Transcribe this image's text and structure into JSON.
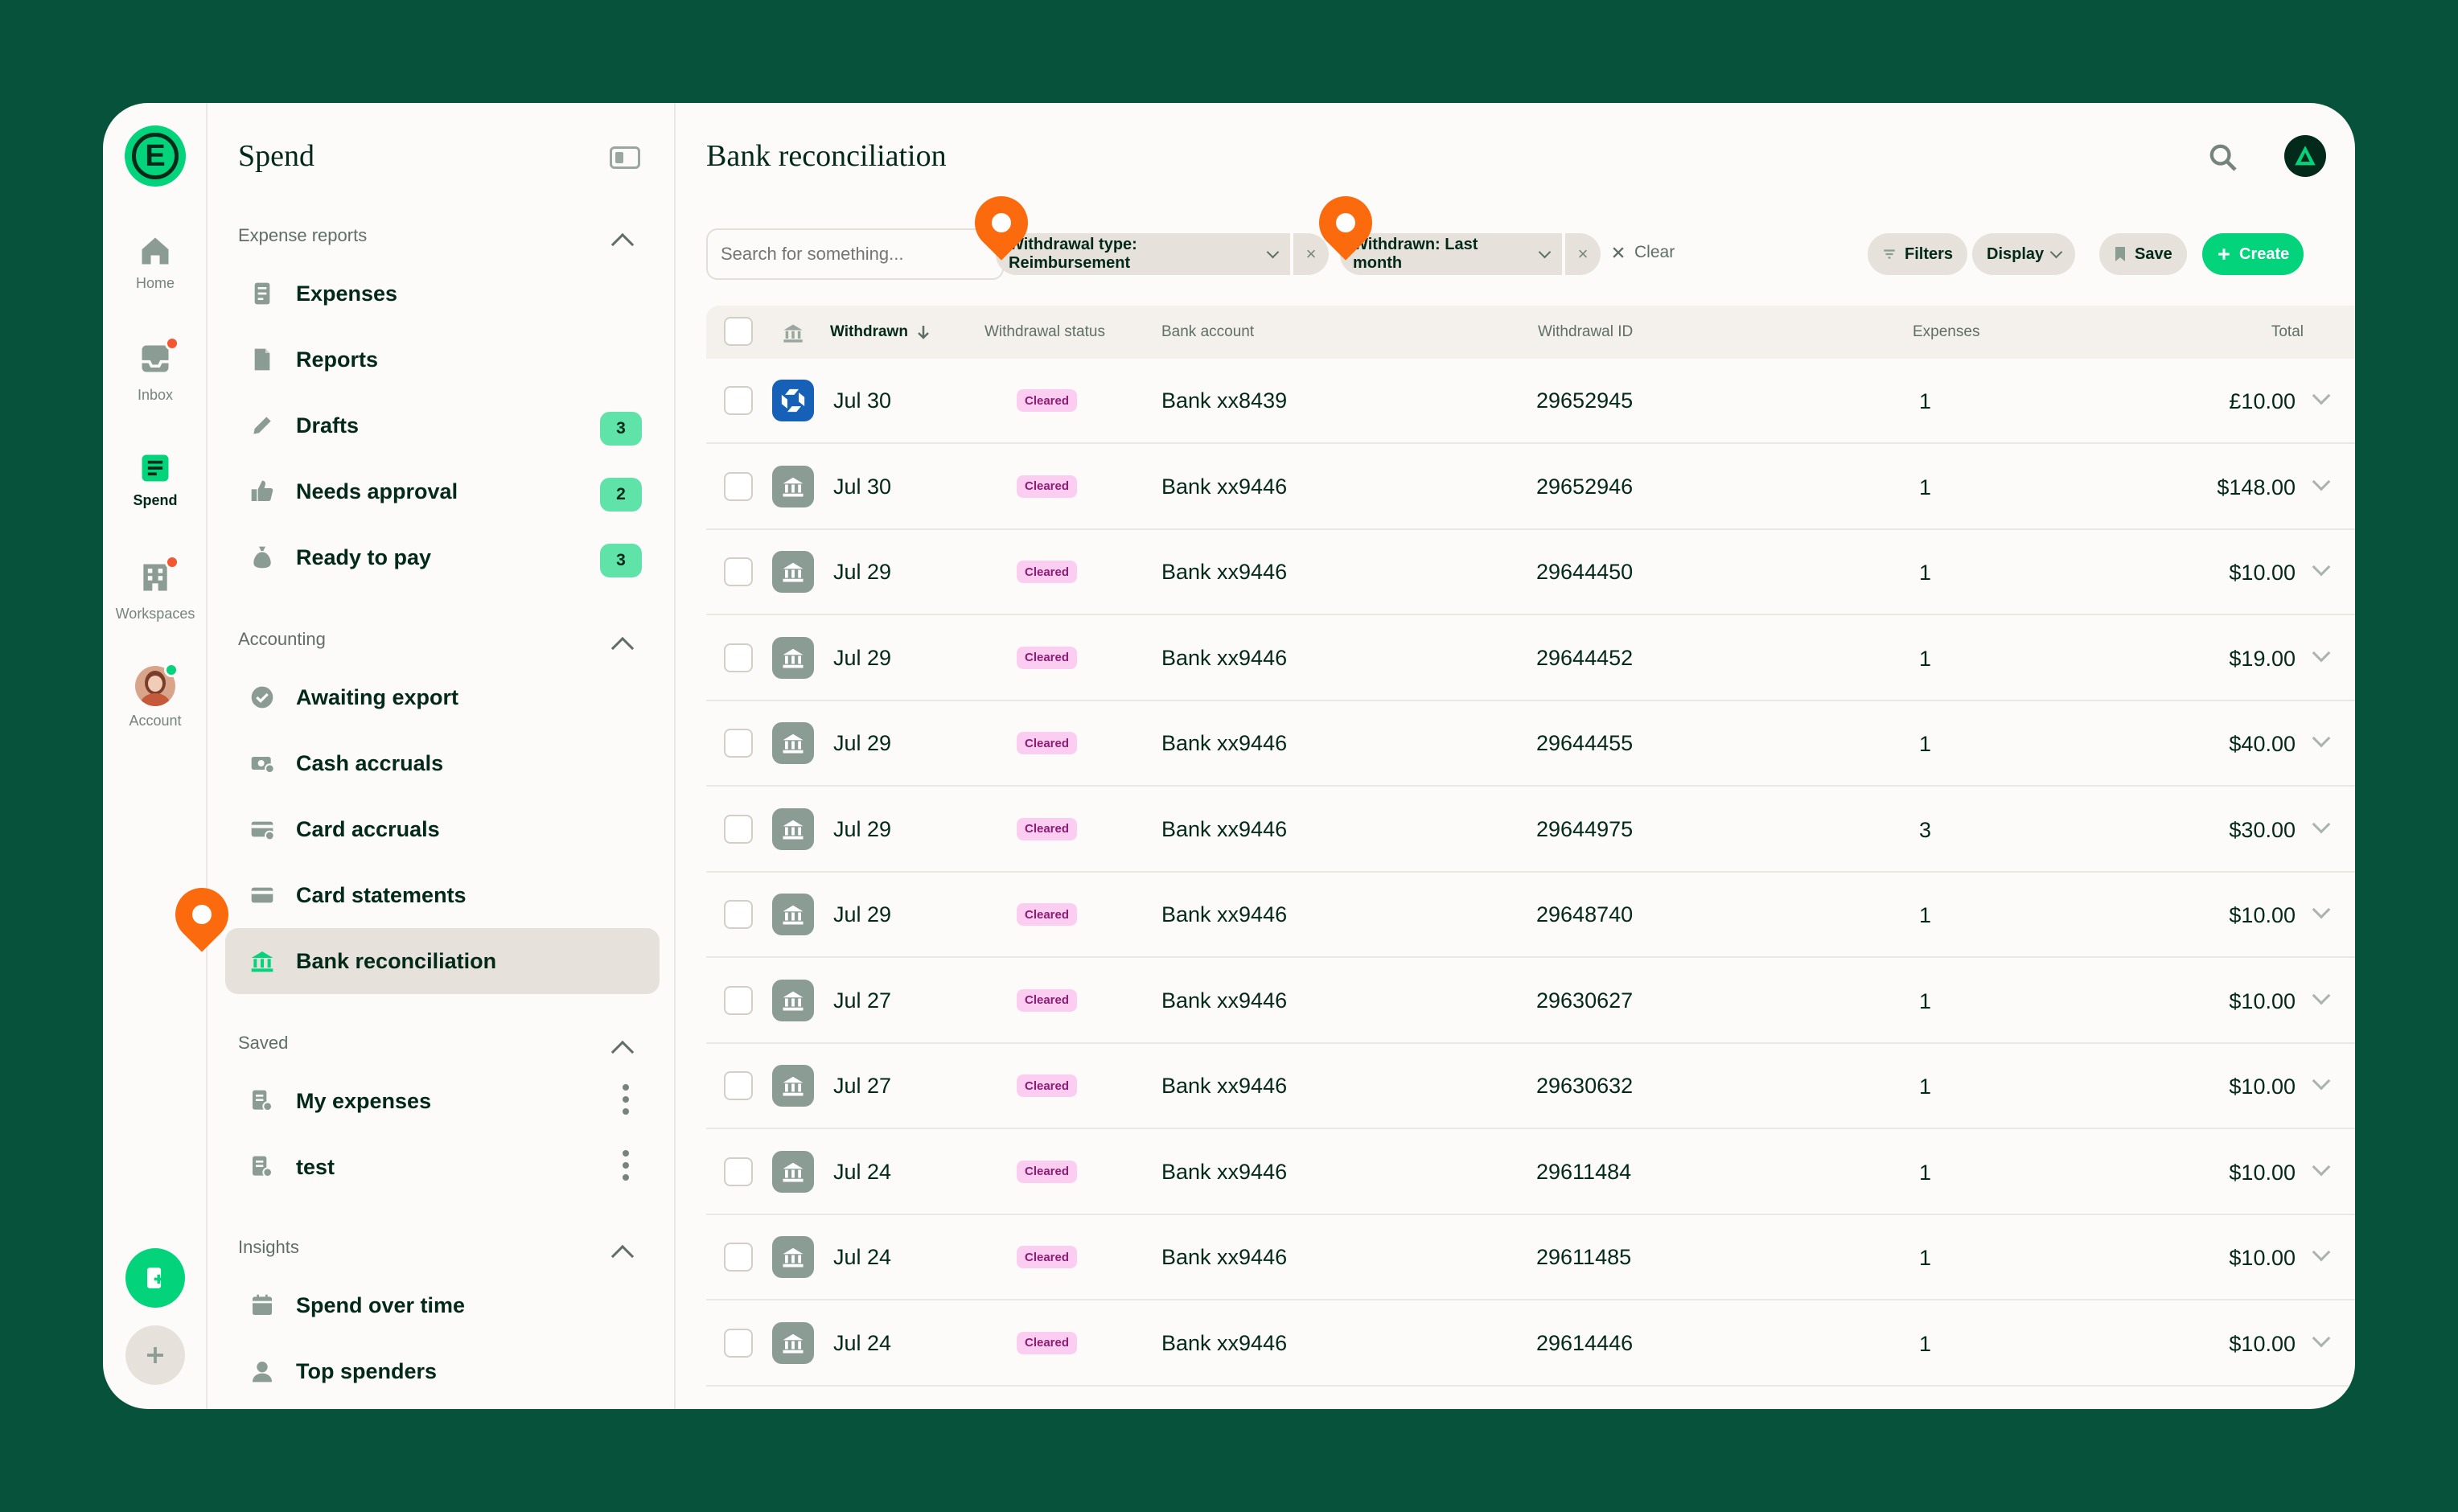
{
  "rail": {
    "items": [
      {
        "label": "Home",
        "icon": "home-icon"
      },
      {
        "label": "Inbox",
        "icon": "inbox-icon"
      },
      {
        "label": "Spend",
        "icon": "spend-icon"
      },
      {
        "label": "Workspaces",
        "icon": "workspaces-icon"
      },
      {
        "label": "Account",
        "icon": "account-avatar"
      }
    ]
  },
  "sidebar": {
    "title": "Spend",
    "sections": [
      {
        "title": "Expense reports",
        "items": [
          {
            "label": "Expenses",
            "icon": "expenses-icon"
          },
          {
            "label": "Reports",
            "icon": "reports-icon"
          },
          {
            "label": "Drafts",
            "icon": "pencil-icon",
            "badge": "3"
          },
          {
            "label": "Needs approval",
            "icon": "thumbs-up-icon",
            "badge": "2"
          },
          {
            "label": "Ready to pay",
            "icon": "money-bag-icon",
            "badge": "3"
          }
        ]
      },
      {
        "title": "Accounting",
        "items": [
          {
            "label": "Awaiting export",
            "icon": "check-circle-icon"
          },
          {
            "label": "Cash accruals",
            "icon": "cash-icon"
          },
          {
            "label": "Card accruals",
            "icon": "card-icon"
          },
          {
            "label": "Card statements",
            "icon": "card-statement-icon"
          },
          {
            "label": "Bank reconciliation",
            "icon": "bank-icon"
          }
        ]
      },
      {
        "title": "Saved",
        "items": [
          {
            "label": "My expenses",
            "icon": "saved-search-icon"
          },
          {
            "label": "test",
            "icon": "saved-search-icon"
          }
        ]
      },
      {
        "title": "Insights",
        "items": [
          {
            "label": "Spend over time",
            "icon": "calendar-icon"
          },
          {
            "label": "Top spenders",
            "icon": "person-icon"
          }
        ]
      }
    ]
  },
  "main": {
    "title": "Bank reconciliation",
    "search_placeholder": "Search for something...",
    "filters": [
      {
        "label": "Withdrawal type: Reimbursement"
      },
      {
        "label": "Withdrawn: Last month"
      }
    ],
    "clear_label": "Clear",
    "toolbar": {
      "filters": "Filters",
      "display": "Display",
      "save": "Save",
      "create": "Create"
    },
    "columns": [
      "Withdrawn",
      "Withdrawal status",
      "Bank account",
      "Withdrawal ID",
      "Expenses",
      "Total"
    ],
    "rows": [
      {
        "date": "Jul 30",
        "status": "Cleared",
        "account": "Bank xx8439",
        "id": "29652945",
        "expenses": "1",
        "total": "£10.00",
        "icon": "chase-bank-icon"
      },
      {
        "date": "Jul 30",
        "status": "Cleared",
        "account": "Bank xx9446",
        "id": "29652946",
        "expenses": "1",
        "total": "$148.00",
        "icon": "bank-icon"
      },
      {
        "date": "Jul 29",
        "status": "Cleared",
        "account": "Bank xx9446",
        "id": "29644450",
        "expenses": "1",
        "total": "$10.00",
        "icon": "bank-icon"
      },
      {
        "date": "Jul 29",
        "status": "Cleared",
        "account": "Bank xx9446",
        "id": "29644452",
        "expenses": "1",
        "total": "$19.00",
        "icon": "bank-icon"
      },
      {
        "date": "Jul 29",
        "status": "Cleared",
        "account": "Bank xx9446",
        "id": "29644455",
        "expenses": "1",
        "total": "$40.00",
        "icon": "bank-icon"
      },
      {
        "date": "Jul 29",
        "status": "Cleared",
        "account": "Bank xx9446",
        "id": "29644975",
        "expenses": "3",
        "total": "$30.00",
        "icon": "bank-icon"
      },
      {
        "date": "Jul 29",
        "status": "Cleared",
        "account": "Bank xx9446",
        "id": "29648740",
        "expenses": "1",
        "total": "$10.00",
        "icon": "bank-icon"
      },
      {
        "date": "Jul 27",
        "status": "Cleared",
        "account": "Bank xx9446",
        "id": "29630627",
        "expenses": "1",
        "total": "$10.00",
        "icon": "bank-icon"
      },
      {
        "date": "Jul 27",
        "status": "Cleared",
        "account": "Bank xx9446",
        "id": "29630632",
        "expenses": "1",
        "total": "$10.00",
        "icon": "bank-icon"
      },
      {
        "date": "Jul 24",
        "status": "Cleared",
        "account": "Bank xx9446",
        "id": "29611484",
        "expenses": "1",
        "total": "$10.00",
        "icon": "bank-icon"
      },
      {
        "date": "Jul 24",
        "status": "Cleared",
        "account": "Bank xx9446",
        "id": "29611485",
        "expenses": "1",
        "total": "$10.00",
        "icon": "bank-icon"
      },
      {
        "date": "Jul 24",
        "status": "Cleared",
        "account": "Bank xx9446",
        "id": "29614446",
        "expenses": "1",
        "total": "$10.00",
        "icon": "bank-icon"
      }
    ]
  },
  "colors": {
    "background": "#07523a",
    "brand_green": "#03d47c",
    "status_cleared_bg": "#fbcdf0",
    "status_cleared_text": "#8a1d74",
    "annotation_pin": "#fb6a0c",
    "notification_dot": "#f25730"
  }
}
